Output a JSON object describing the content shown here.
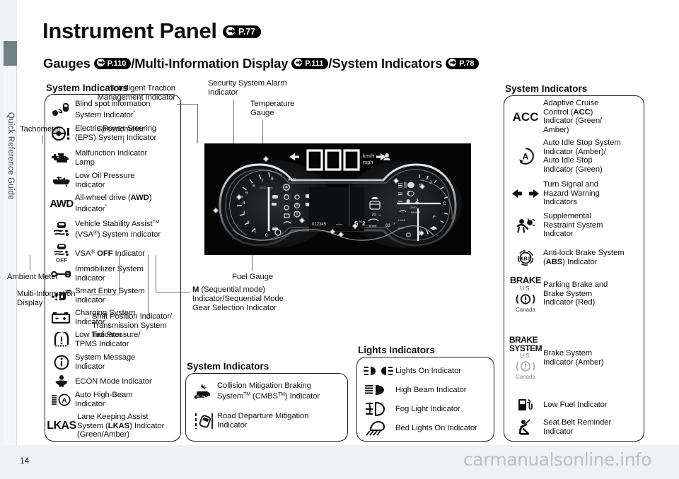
{
  "sidebar": {
    "label": "Quick Reference Guide"
  },
  "header": {
    "title": "Instrument Panel",
    "title_ref": "P.77",
    "sub_gauges": "Gauges",
    "sub_gauges_ref": "P.110",
    "sub_mid": "/Multi-Information Display",
    "sub_mid_ref": "P.111",
    "sub_sys": "/System Indicators",
    "sub_sys_ref": "P.78"
  },
  "sections": {
    "left_label": "System Indicators",
    "right_label": "System Indicators",
    "center_label": "System Indicators",
    "lights_label": "Lights Indicators"
  },
  "left_indicators": [
    {
      "icon": "blind-spot-icon",
      "text": "Blind spot information\nSystem Indicator*"
    },
    {
      "icon": "steering-wheel-exclamation-icon",
      "text": "Electric Power Steering\n(EPS) System Indicator"
    },
    {
      "icon": "engine-malfunction-icon",
      "text": "Malfunction Indicator\nLamp"
    },
    {
      "icon": "oil-can-icon",
      "text": "Low Oil Pressure\nIndicator"
    },
    {
      "icon": "awd-text-icon",
      "text": "All-wheel drive (AWD)\nIndicator*"
    },
    {
      "icon": "vsa-car-skid-icon",
      "text": "Vehicle Stability AssistTM\n(VSA(R)) System Indicator"
    },
    {
      "icon": "vsa-off-icon",
      "text": "VSA(R) OFF Indicator"
    },
    {
      "icon": "key-immobilizer-icon",
      "text": "Immobilizer System\nIndicator"
    },
    {
      "icon": "smart-entry-icon",
      "text": "Smart Entry System\nIndicator"
    },
    {
      "icon": "battery-charging-icon",
      "text": "Charging System\nIndicator"
    },
    {
      "icon": "tire-pressure-icon",
      "text": "Low Tire Pressure/\nTPMS Indicator"
    },
    {
      "icon": "info-circle-icon",
      "text": "System Message\nIndicator"
    },
    {
      "icon": "econ-leaf-icon",
      "text": "ECON Mode Indicator"
    },
    {
      "icon": "auto-high-beam-icon",
      "text": "Auto High-Beam\nIndicator"
    },
    {
      "icon": "lkas-text-icon",
      "text": "Lane Keeping Assist\nSystem (LKAS) Indicator\n(Green/Amber)"
    }
  ],
  "center_indicators": [
    {
      "icon": "cmbs-collision-icon",
      "text": "Collision Mitigation Braking\nSystemTM (CMBSTM) Indicator"
    },
    {
      "icon": "road-departure-icon",
      "text": "Road Departure Mitigation\nIndicator"
    }
  ],
  "lights_indicators": [
    {
      "icon": "lights-on-icon",
      "text": "Lights On Indicator"
    },
    {
      "icon": "high-beam-icon",
      "text": "High Beam Indicator"
    },
    {
      "icon": "fog-light-icon",
      "text": "Fog Light Indicator"
    },
    {
      "icon": "bed-lights-icon",
      "text": "Bed Lights On Indicator"
    }
  ],
  "right_indicators": [
    {
      "icon": "acc-text-icon",
      "text": "Adaptive Cruise\nControl (ACC)\nIndicator (Green/\nAmber)"
    },
    {
      "icon": "auto-idle-stop-icon",
      "text": "Auto Idle Stop System\nIndicator (Amber)/\nAuto Idle Stop\nIndicator (Green)"
    },
    {
      "icon": "turn-signal-arrows-icon",
      "text": "Turn Signal and\nHazard Warning\nIndicators"
    },
    {
      "icon": "srs-airbag-icon",
      "text": "Supplemental\nRestraint System\nIndicator"
    },
    {
      "icon": "abs-icon",
      "text": "Anti-lock Brake System\n(ABS) Indicator"
    },
    {
      "icon": "brake-parking-icon",
      "text": "Parking Brake and\nBrake System\nIndicator (Red)"
    },
    {
      "icon": "brake-system-amber-icon",
      "text": "Brake System\nIndicator (Amber)"
    },
    {
      "icon": "low-fuel-icon",
      "text": "Low Fuel Indicator"
    },
    {
      "icon": "seat-belt-icon",
      "text": "Seat Belt Reminder\nIndicator"
    }
  ],
  "icon_labels": {
    "brake_us": "BRAKE",
    "brake_system_us": "BRAKE\nSYSTEM",
    "us": "U.S.",
    "canada": "Canada",
    "awd": "AWD",
    "lkas": "LKAS",
    "acc": "ACC",
    "off": "OFF",
    "abs": "ABS",
    "a": "A"
  },
  "callouts": {
    "tachometer": "Tachometer",
    "speedometer": "Speedometer",
    "itm": "Intelligent Traction\nManagement Indicator",
    "security": "Security System Alarm\nIndicator",
    "temp": "Temperature\nGauge",
    "ambient": "Ambient Meter",
    "mid": "Multi-Information\nDisplay",
    "shift": "Shift Position Indicator/\nTransmission System\nIndicator",
    "mseq": "M (Sequential mode)\nIndicator/Sequential Mode\nGear Selection Indicator",
    "fuel": "Fuel Gauge"
  },
  "cluster": {
    "speed_digits": "000",
    "units": "km/h\nmph",
    "odometer": "012345 miles",
    "gear": "S 2",
    "drive_mode": "Snow",
    "temperature": "63°F",
    "range": "70 mi",
    "tach_ticks": [
      "0",
      "1",
      "2",
      "3",
      "4",
      "5",
      "6",
      "7",
      "8"
    ],
    "tach_unit": "x1000 r/min",
    "temp_marks": [
      "H",
      "C"
    ],
    "fuel_marks": [
      "F",
      "E"
    ],
    "side_labels": [
      "2WD",
      "LKAS",
      "ACC",
      "BRAKE"
    ]
  },
  "footer": {
    "page": "14",
    "watermark": "carmanualsonline.info"
  },
  "colors": {
    "tab": "#6f8186",
    "edge": "#eef2f4",
    "ink": "#111111",
    "lead": "#6e6e6e"
  }
}
